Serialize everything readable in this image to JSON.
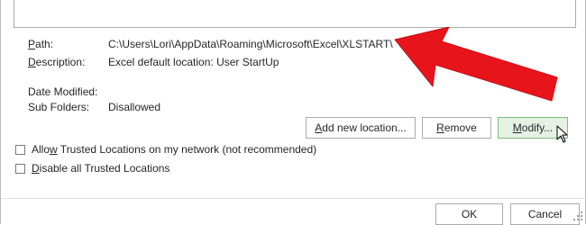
{
  "location": {
    "path_label_prefix": "P",
    "path_label_rest": "ath:",
    "path_value": "C:\\Users\\Lori\\AppData\\Roaming\\Microsoft\\Excel\\XLSTART\\",
    "description_label_prefix": "D",
    "description_label_rest": "escription:",
    "description_value": "Excel default location: User StartUp",
    "date_modified_label": "Date Modified:",
    "date_modified_value": "",
    "sub_folders_label": "Sub Folders:",
    "sub_folders_value": "Disallowed"
  },
  "buttons": {
    "add_new_prefix": "A",
    "add_new_rest": "dd new location...",
    "remove_prefix": "R",
    "remove_rest": "emove",
    "modify_prefix": "M",
    "modify_rest": "odify..."
  },
  "options": {
    "allow_network_pre": "Allo",
    "allow_network_key": "w",
    "allow_network_post": " Trusted Locations on my network (not recommended)",
    "allow_network_checked": false,
    "disable_all_key": "D",
    "disable_all_post": "isable all Trusted Locations",
    "disable_all_checked": false
  },
  "footer": {
    "ok_label": "OK",
    "cancel_label": "Cancel"
  },
  "colors": {
    "arrow": "#e8141b",
    "hover_button": "#e5f1e5"
  },
  "icons": {
    "annotation": "red-arrow-icon",
    "pointer": "mouse-pointer-icon",
    "grip": "resize-grip-icon"
  }
}
